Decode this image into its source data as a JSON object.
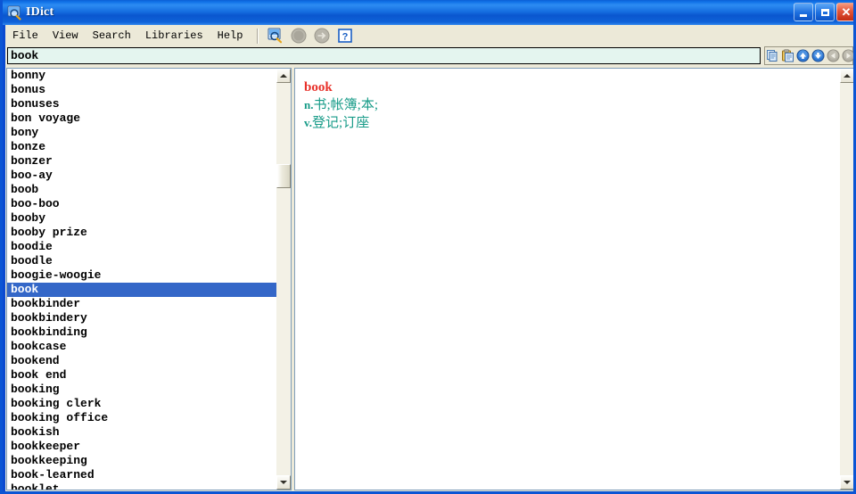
{
  "window": {
    "title": "IDict",
    "icon": "dictionary-magnifier-icon",
    "controls": [
      {
        "name": "minimize-button",
        "label": "_"
      },
      {
        "name": "maximize-button",
        "label": "□"
      },
      {
        "name": "close-button",
        "label": "✕"
      }
    ]
  },
  "menubar": {
    "items": [
      {
        "label": "File"
      },
      {
        "label": "View"
      },
      {
        "label": "Search"
      },
      {
        "label": "Libraries"
      },
      {
        "label": "Help"
      }
    ],
    "toolbar_icons": [
      {
        "name": "search-document-icon",
        "enabled": true
      },
      {
        "name": "back-circle-icon",
        "enabled": false
      },
      {
        "name": "forward-circle-icon",
        "enabled": false
      },
      {
        "name": "help-question-icon",
        "enabled": true,
        "label": "?"
      }
    ]
  },
  "search": {
    "value": "book",
    "placeholder": "",
    "buttons": [
      {
        "name": "copy-button",
        "label": "❐"
      },
      {
        "name": "paste-button",
        "label": "Ὄb"
      },
      {
        "name": "scroll-up-button",
        "label": "▲"
      },
      {
        "name": "scroll-down-button",
        "label": "▼"
      },
      {
        "name": "nav-back-button",
        "label": "◀"
      },
      {
        "name": "nav-forward-button",
        "label": "▶"
      }
    ]
  },
  "wordlist": {
    "selected": "book",
    "items": [
      "bonny",
      "bonus",
      "bonuses",
      "bon voyage",
      "bony",
      "bonze",
      "bonzer",
      "boo-ay",
      "boob",
      "boo-boo",
      "booby",
      "booby prize",
      "boodie",
      "boodle",
      "boogie-woogie",
      "book",
      "bookbinder",
      "bookbindery",
      "bookbinding",
      "bookcase",
      "bookend",
      "book end",
      "booking",
      "booking clerk",
      "booking office",
      "bookish",
      "bookkeeper",
      "bookkeeping",
      "book-learned",
      "booklet"
    ]
  },
  "definition": {
    "headword": "book",
    "entries": [
      {
        "pos": "n.",
        "text": "书;帐簿;本;"
      },
      {
        "pos": "v.",
        "text": "登记;订座"
      }
    ]
  },
  "colors": {
    "title_blue": "#0b55d4",
    "selection_blue": "#3467c8",
    "headword_red": "#e8312a",
    "definition_teal": "#179b88",
    "chrome": "#ece9d8",
    "search_field": "#e4f5ef"
  }
}
